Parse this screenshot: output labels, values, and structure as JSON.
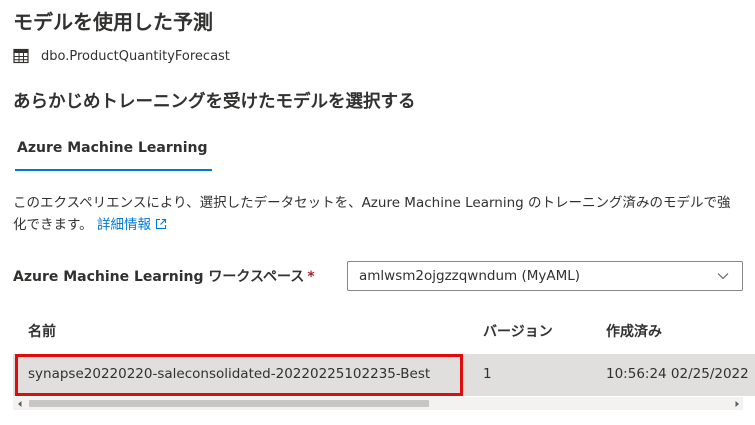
{
  "panel": {
    "title": "モデルを使用した予測",
    "table_name": "dbo.ProductQuantityForecast"
  },
  "section_title": "あらかじめトレーニングを受けたモデルを選択する",
  "tabs": [
    {
      "label": "Azure Machine Learning",
      "selected": true
    }
  ],
  "description": {
    "text": "このエクスペリエンスにより、選択したデータセットを、Azure Machine Learning のトレーニング済みのモデルで強化できます。",
    "link_label": "詳細情報"
  },
  "workspace": {
    "label": "Azure Machine Learning ワークスペース",
    "required_marker": "*",
    "selected_value": "amlwsm2ojgzzqwndum (MyAML)"
  },
  "models_table": {
    "columns": [
      "名前",
      "バージョン",
      "作成済み"
    ],
    "rows": [
      {
        "name": "synapse20220220-saleconsolidated-20220225102235-Best",
        "version": "1",
        "created": "10:56:24 02/25/2022"
      }
    ]
  },
  "colors": {
    "accent": "#0078d4",
    "highlight_border": "#e00b0b",
    "selected_row": "#e1dfdd",
    "required": "#a4262c"
  },
  "icons": {
    "table": "table-icon",
    "external_link": "external-link-icon",
    "dropdown": "chevron-down-icon",
    "scroll_left": "caret-left-icon",
    "scroll_right": "caret-right-icon"
  }
}
